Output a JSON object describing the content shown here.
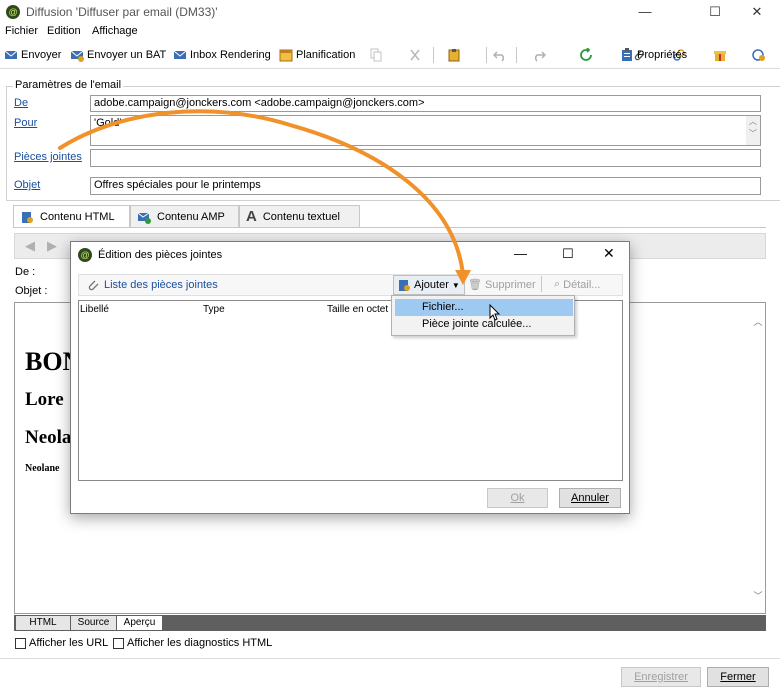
{
  "window": {
    "title": "Diffusion 'Diffuser par email (DM33)'",
    "app_icon": "campaign-app-icon",
    "controls": [
      "—",
      "☐",
      "✕"
    ]
  },
  "menu": [
    "Fichier",
    "Edition",
    "Affichage"
  ],
  "toolbar": {
    "send": "Envoyer",
    "send_proof": "Envoyer un BAT",
    "inbox_rendering": "Inbox Rendering",
    "schedule": "Planification",
    "properties": "Propriétés"
  },
  "params": {
    "section_title": "Paramètres de l'email",
    "from_label": "De",
    "from_value": "adobe.campaign@jonckers.com <adobe.campaign@jonckers.com>",
    "to_label": "Pour",
    "to_value": "'Gold'",
    "attachments_label": "Pièces jointes",
    "attachments_value": "",
    "subject_label": "Objet",
    "subject_value": "Offres spéciales pour le printemps"
  },
  "content_tabs": [
    "Contenu HTML",
    "Contenu AMP",
    "Contenu textuel"
  ],
  "header_fields": {
    "from": "De :",
    "subject": "Objet :"
  },
  "preview": {
    "h1": "BON",
    "h2a": "Lore",
    "h2b": "Neola",
    "small": "Neolane"
  },
  "bottom_tabs": [
    "HTML",
    "Source",
    "Aperçu"
  ],
  "checkboxes": [
    "Afficher les URL",
    "Afficher les diagnostics HTML"
  ],
  "footer": {
    "save": "Enregistrer",
    "close": "Fermer"
  },
  "dialog": {
    "title": "Édition des pièces jointes",
    "list_link": "Liste des pièces jointes",
    "add": "Ajouter",
    "delete": "Supprimer",
    "detail": "Détail...",
    "columns": [
      "Libellé",
      "Type",
      "Taille en octet"
    ],
    "ok": "Ok",
    "cancel": "Annuler"
  },
  "dropdown": [
    "Fichier...",
    "Pièce jointe calculée..."
  ],
  "colors": {
    "accent_arrow": "#f0912a",
    "link": "#1a4fa0",
    "highlight": "#9ec9f0"
  }
}
